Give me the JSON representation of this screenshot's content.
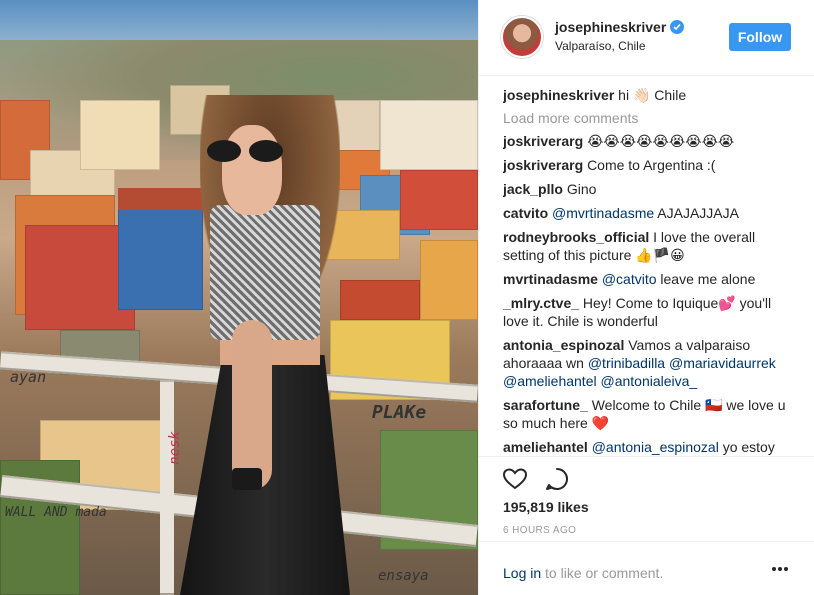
{
  "post": {
    "username": "josephineskriver",
    "location": "Valparaíso, Chile",
    "follow_label": "Follow",
    "verified_icon": "verified-badge-icon",
    "caption_user": "josephineskriver",
    "caption_text": "hi 👋🏻 Chile"
  },
  "comments": {
    "load_more": "Load more comments",
    "items": [
      {
        "user": "joskriverarg",
        "text": "😭😭😭😭😭😭😭😭😭"
      },
      {
        "user": "joskriverarg",
        "text": "Come to Argentina :("
      },
      {
        "user": "jack_pllo",
        "text": "Gino"
      },
      {
        "user": "catvito",
        "mention": "@mvrtinadasme",
        "text": " AJAJAJJAJA"
      },
      {
        "user": "rodneybrooks_official",
        "text": "I love the overall setting of this picture 👍🏴😀"
      },
      {
        "user": "mvrtinadasme",
        "mention": "@catvito",
        "text": " leave me alone"
      },
      {
        "user": "_mlry.ctve_",
        "text": "Hey! Come to Iquique💕 you'll love it. Chile is wonderful"
      },
      {
        "user": "antonia_espinozal",
        "text": "Vamos a valparaiso ahoraaaa wn ",
        "mention": "@trinibadilla @mariavidaurrek @ameliehantel @antonialeiva_"
      },
      {
        "user": "sarafortune_",
        "text": "Welcome to Chile 🇨🇱 we love u so much here ❤️"
      },
      {
        "user": "ameliehantel",
        "mention": "@antonia_espinozal",
        "text": " yo estoy"
      }
    ]
  },
  "actions": {
    "like_icon": "heart-icon",
    "comment_icon": "comment-icon",
    "likes": "195,819 likes",
    "time": "6 HOURS AGO"
  },
  "footer": {
    "login_link": "Log in",
    "login_suffix": " to like or comment.",
    "more_icon": "more-options-icon"
  },
  "photo": {
    "graffiti_1": "ayan",
    "graffiti_2": "PLAKe",
    "graffiti_3": "nesk",
    "graffiti_4": "WALL AND mada",
    "graffiti_5": "ensaya"
  },
  "colors": {
    "accent": "#3897f0",
    "link": "#003569",
    "muted": "#999999"
  }
}
